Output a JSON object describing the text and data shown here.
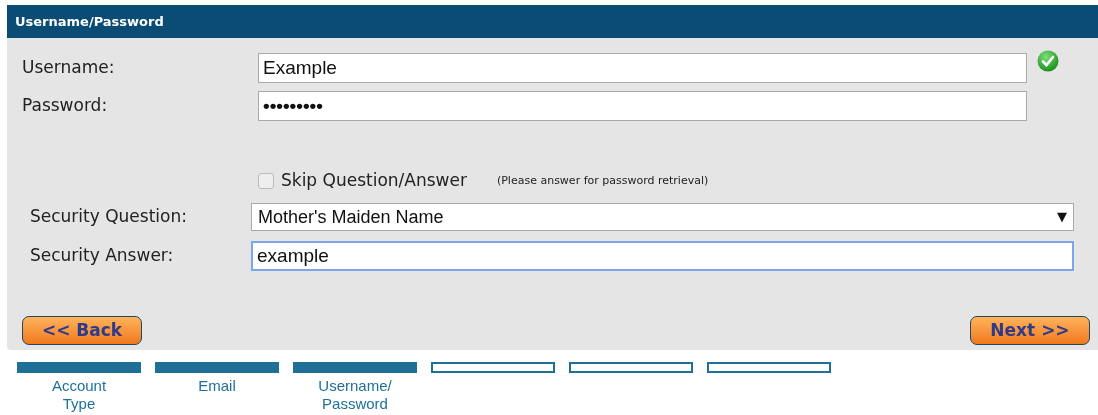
{
  "panel": {
    "title": "Username/Password"
  },
  "username": {
    "label": "Username:",
    "value": "Example",
    "valid": true
  },
  "password": {
    "label": "Password:",
    "value": "•••••••••"
  },
  "skip": {
    "label": "Skip Question/Answer",
    "checked": false,
    "note": "(Please answer for password retrieval)"
  },
  "security_question": {
    "label": "Security Question:",
    "value": "Mother's Maiden Name",
    "arrow": "▼"
  },
  "security_answer": {
    "label": "Security Answer:",
    "value": "example",
    "focused": true
  },
  "buttons": [
    {
      "label": "<< Back"
    },
    {
      "label": "Next >>"
    }
  ],
  "steps": [
    {
      "label": "Account Type",
      "completed": true
    },
    {
      "label": "Email",
      "completed": true
    },
    {
      "label": "Username/ Password",
      "completed": true
    },
    {
      "completed": false
    },
    {
      "completed": false
    },
    {
      "completed": false
    }
  ]
}
